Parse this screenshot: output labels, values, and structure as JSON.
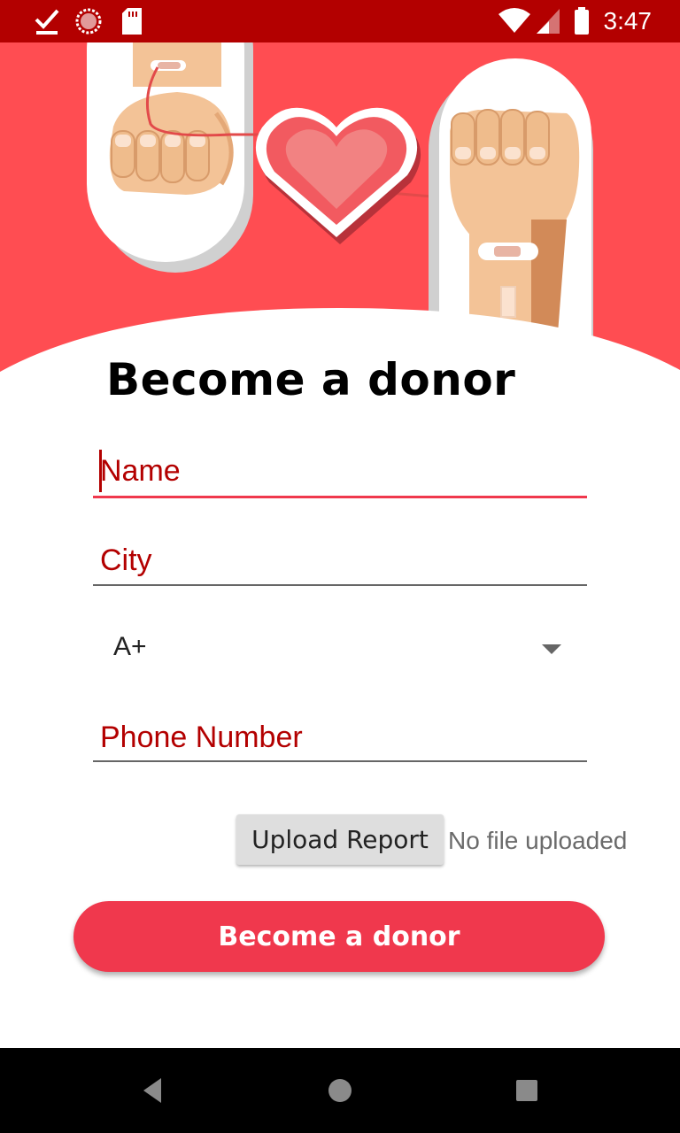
{
  "status_bar": {
    "time": "3:47",
    "icons": [
      "download-done-icon",
      "loading-icon",
      "sd-card-icon",
      "wifi-icon",
      "signal-icon",
      "battery-icon"
    ]
  },
  "hero": {
    "illustration": "blood-donation-illustration"
  },
  "form": {
    "title": "Become a donor",
    "name_placeholder": "Name",
    "city_placeholder": "City",
    "blood_group_selected": "A+",
    "phone_placeholder": "Phone Number",
    "upload_button_label": "Upload Report",
    "upload_status": "No file uploaded",
    "submit_label": "Become a donor"
  },
  "nav_bar": {
    "icons": [
      "back-icon",
      "home-icon",
      "recents-icon"
    ]
  },
  "colors": {
    "status_bar": "#b30000",
    "accent": "#f0384d",
    "hero_bg": "#ff4d52"
  }
}
